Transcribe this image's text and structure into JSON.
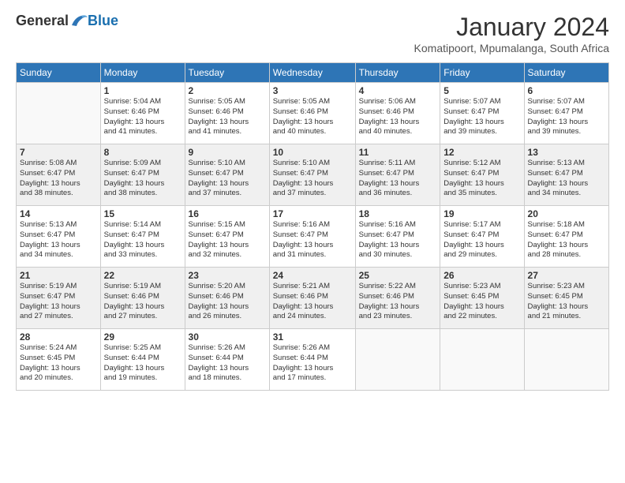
{
  "logo": {
    "general": "General",
    "blue": "Blue"
  },
  "title": "January 2024",
  "subtitle": "Komatipoort, Mpumalanga, South Africa",
  "days_of_week": [
    "Sunday",
    "Monday",
    "Tuesday",
    "Wednesday",
    "Thursday",
    "Friday",
    "Saturday"
  ],
  "weeks": [
    [
      {
        "day": "",
        "info": ""
      },
      {
        "day": "1",
        "info": "Sunrise: 5:04 AM\nSunset: 6:46 PM\nDaylight: 13 hours\nand 41 minutes."
      },
      {
        "day": "2",
        "info": "Sunrise: 5:05 AM\nSunset: 6:46 PM\nDaylight: 13 hours\nand 41 minutes."
      },
      {
        "day": "3",
        "info": "Sunrise: 5:05 AM\nSunset: 6:46 PM\nDaylight: 13 hours\nand 40 minutes."
      },
      {
        "day": "4",
        "info": "Sunrise: 5:06 AM\nSunset: 6:46 PM\nDaylight: 13 hours\nand 40 minutes."
      },
      {
        "day": "5",
        "info": "Sunrise: 5:07 AM\nSunset: 6:47 PM\nDaylight: 13 hours\nand 39 minutes."
      },
      {
        "day": "6",
        "info": "Sunrise: 5:07 AM\nSunset: 6:47 PM\nDaylight: 13 hours\nand 39 minutes."
      }
    ],
    [
      {
        "day": "7",
        "info": "Sunrise: 5:08 AM\nSunset: 6:47 PM\nDaylight: 13 hours\nand 38 minutes."
      },
      {
        "day": "8",
        "info": "Sunrise: 5:09 AM\nSunset: 6:47 PM\nDaylight: 13 hours\nand 38 minutes."
      },
      {
        "day": "9",
        "info": "Sunrise: 5:10 AM\nSunset: 6:47 PM\nDaylight: 13 hours\nand 37 minutes."
      },
      {
        "day": "10",
        "info": "Sunrise: 5:10 AM\nSunset: 6:47 PM\nDaylight: 13 hours\nand 37 minutes."
      },
      {
        "day": "11",
        "info": "Sunrise: 5:11 AM\nSunset: 6:47 PM\nDaylight: 13 hours\nand 36 minutes."
      },
      {
        "day": "12",
        "info": "Sunrise: 5:12 AM\nSunset: 6:47 PM\nDaylight: 13 hours\nand 35 minutes."
      },
      {
        "day": "13",
        "info": "Sunrise: 5:13 AM\nSunset: 6:47 PM\nDaylight: 13 hours\nand 34 minutes."
      }
    ],
    [
      {
        "day": "14",
        "info": "Sunrise: 5:13 AM\nSunset: 6:47 PM\nDaylight: 13 hours\nand 34 minutes."
      },
      {
        "day": "15",
        "info": "Sunrise: 5:14 AM\nSunset: 6:47 PM\nDaylight: 13 hours\nand 33 minutes."
      },
      {
        "day": "16",
        "info": "Sunrise: 5:15 AM\nSunset: 6:47 PM\nDaylight: 13 hours\nand 32 minutes."
      },
      {
        "day": "17",
        "info": "Sunrise: 5:16 AM\nSunset: 6:47 PM\nDaylight: 13 hours\nand 31 minutes."
      },
      {
        "day": "18",
        "info": "Sunrise: 5:16 AM\nSunset: 6:47 PM\nDaylight: 13 hours\nand 30 minutes."
      },
      {
        "day": "19",
        "info": "Sunrise: 5:17 AM\nSunset: 6:47 PM\nDaylight: 13 hours\nand 29 minutes."
      },
      {
        "day": "20",
        "info": "Sunrise: 5:18 AM\nSunset: 6:47 PM\nDaylight: 13 hours\nand 28 minutes."
      }
    ],
    [
      {
        "day": "21",
        "info": "Sunrise: 5:19 AM\nSunset: 6:47 PM\nDaylight: 13 hours\nand 27 minutes."
      },
      {
        "day": "22",
        "info": "Sunrise: 5:19 AM\nSunset: 6:46 PM\nDaylight: 13 hours\nand 27 minutes."
      },
      {
        "day": "23",
        "info": "Sunrise: 5:20 AM\nSunset: 6:46 PM\nDaylight: 13 hours\nand 26 minutes."
      },
      {
        "day": "24",
        "info": "Sunrise: 5:21 AM\nSunset: 6:46 PM\nDaylight: 13 hours\nand 24 minutes."
      },
      {
        "day": "25",
        "info": "Sunrise: 5:22 AM\nSunset: 6:46 PM\nDaylight: 13 hours\nand 23 minutes."
      },
      {
        "day": "26",
        "info": "Sunrise: 5:23 AM\nSunset: 6:45 PM\nDaylight: 13 hours\nand 22 minutes."
      },
      {
        "day": "27",
        "info": "Sunrise: 5:23 AM\nSunset: 6:45 PM\nDaylight: 13 hours\nand 21 minutes."
      }
    ],
    [
      {
        "day": "28",
        "info": "Sunrise: 5:24 AM\nSunset: 6:45 PM\nDaylight: 13 hours\nand 20 minutes."
      },
      {
        "day": "29",
        "info": "Sunrise: 5:25 AM\nSunset: 6:44 PM\nDaylight: 13 hours\nand 19 minutes."
      },
      {
        "day": "30",
        "info": "Sunrise: 5:26 AM\nSunset: 6:44 PM\nDaylight: 13 hours\nand 18 minutes."
      },
      {
        "day": "31",
        "info": "Sunrise: 5:26 AM\nSunset: 6:44 PM\nDaylight: 13 hours\nand 17 minutes."
      },
      {
        "day": "",
        "info": ""
      },
      {
        "day": "",
        "info": ""
      },
      {
        "day": "",
        "info": ""
      }
    ]
  ]
}
